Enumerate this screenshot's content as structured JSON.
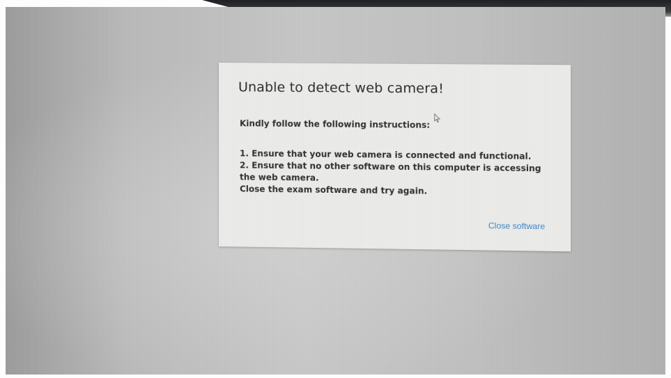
{
  "dialog": {
    "title": "Unable to detect web camera!",
    "intro": "Kindly follow the following instructions:",
    "steps": [
      "1. Ensure that your web camera is connected and functional.",
      "2. Ensure that no other software on this computer is accessing the web camera.",
      "Close the exam software and try again."
    ],
    "close_label": "Close software"
  },
  "colors": {
    "screen_background": "#c0c0c0",
    "dialog_background": "#ececea",
    "title_text": "#2a2a2a",
    "link": "#3a86c8"
  },
  "icons": {
    "cursor": "mouse-pointer-icon"
  }
}
